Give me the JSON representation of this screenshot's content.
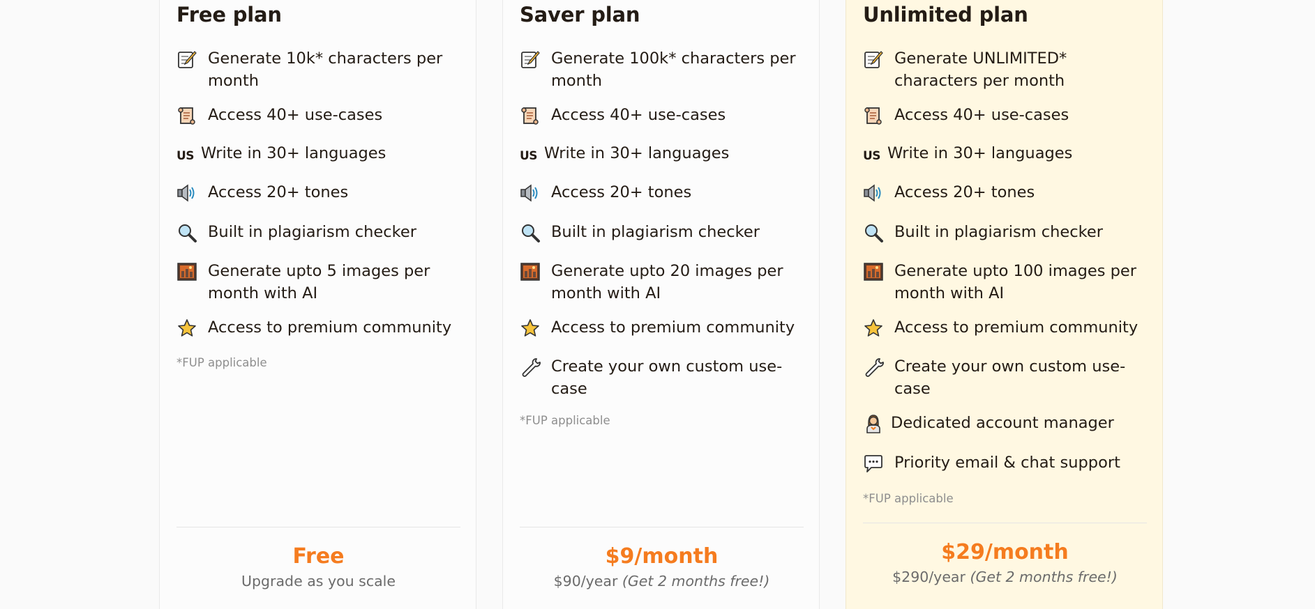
{
  "plans": [
    {
      "title": "Free plan",
      "features": [
        {
          "icon": "memo-icon",
          "text": "Generate 10k* characters per month"
        },
        {
          "icon": "scroll-icon",
          "text": "Access 40+ use-cases"
        },
        {
          "icon": "us-flag-icon",
          "icon_text": "US",
          "text": "Write in 30+ languages"
        },
        {
          "icon": "speaker-icon",
          "text": "Access 20+ tones"
        },
        {
          "icon": "magnifier-icon",
          "text": "Built in plagiarism checker"
        },
        {
          "icon": "picture-icon",
          "text": "Generate upto 5 images per month with AI"
        },
        {
          "icon": "star-icon",
          "text": "Access to premium community"
        }
      ],
      "fup": "*FUP applicable",
      "price": "Free",
      "price_sub": "Upgrade as you scale",
      "price_sub_note": ""
    },
    {
      "title": "Saver plan",
      "features": [
        {
          "icon": "memo-icon",
          "text": "Generate 100k* characters per month"
        },
        {
          "icon": "scroll-icon",
          "text": "Access 40+ use-cases"
        },
        {
          "icon": "us-flag-icon",
          "icon_text": "US",
          "text": "Write in 30+ languages"
        },
        {
          "icon": "speaker-icon",
          "text": "Access 20+ tones"
        },
        {
          "icon": "magnifier-icon",
          "text": "Built in plagiarism checker"
        },
        {
          "icon": "picture-icon",
          "text": "Generate upto 20 images per month with AI"
        },
        {
          "icon": "star-icon",
          "text": "Access to premium community"
        },
        {
          "icon": "wrench-icon",
          "text": "Create your own custom use-case"
        }
      ],
      "fup": "*FUP applicable",
      "price": "$9/month",
      "price_sub": "$90/year ",
      "price_sub_note": "(Get 2 months free!)"
    },
    {
      "title": "Unlimited plan",
      "features": [
        {
          "icon": "memo-icon",
          "text": "Generate UNLIMITED* characters per month"
        },
        {
          "icon": "scroll-icon",
          "text": "Access 40+ use-cases"
        },
        {
          "icon": "us-flag-icon",
          "icon_text": "US",
          "text": "Write in 30+ languages"
        },
        {
          "icon": "speaker-icon",
          "text": "Access 20+ tones"
        },
        {
          "icon": "magnifier-icon",
          "text": "Built in plagiarism checker"
        },
        {
          "icon": "picture-icon",
          "text": "Generate upto 100 images per month with AI"
        },
        {
          "icon": "star-icon",
          "text": "Access to premium community"
        },
        {
          "icon": "wrench-icon",
          "text": "Create your own custom use-case"
        },
        {
          "icon": "person-icon",
          "text": "Dedicated account manager"
        },
        {
          "icon": "speech-bubble-icon",
          "text": "Priority email & chat support"
        }
      ],
      "fup": "*FUP applicable",
      "price": "$29/month",
      "price_sub": "$290/year ",
      "price_sub_note": "(Get 2 months free!)"
    }
  ],
  "colors": {
    "price": "#f57c1f",
    "highlight_background": "#fff8e2",
    "text": "#241c15",
    "muted": "#8e8e8e"
  }
}
